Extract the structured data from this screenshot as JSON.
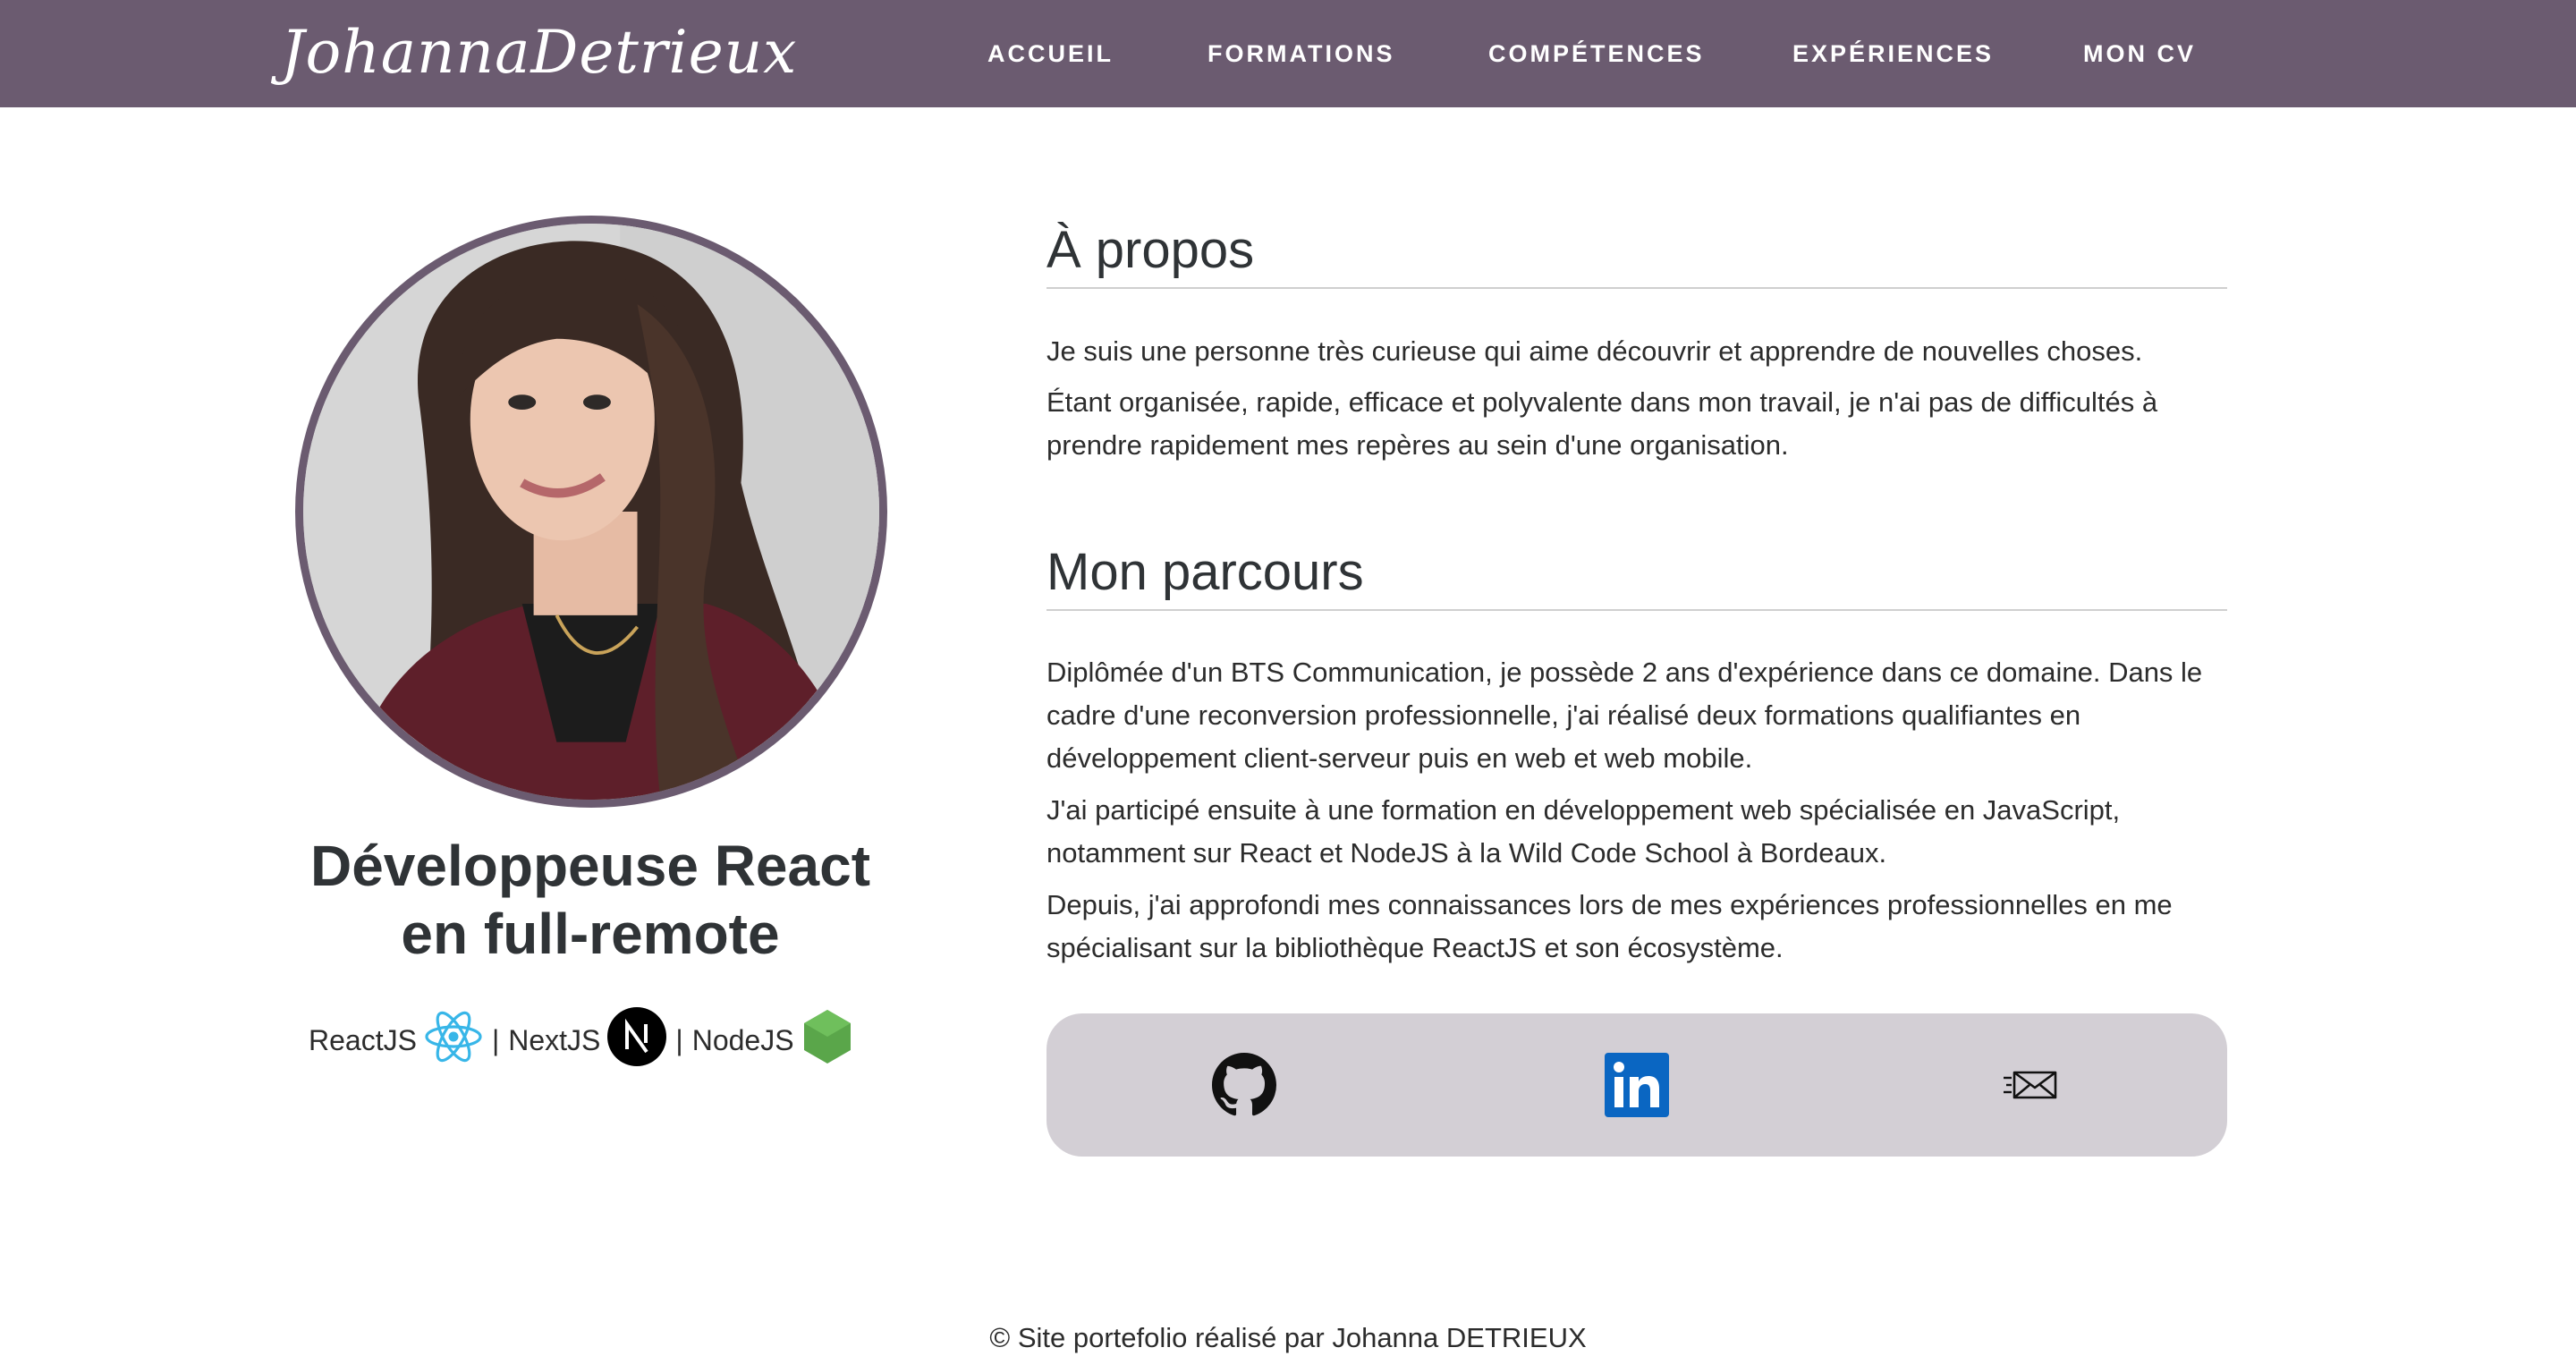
{
  "navbar": {
    "brand": "JohannaDetrieux",
    "items": [
      "ACCUEIL",
      "FORMATIONS",
      "COMPÉTENCES",
      "EXPÉRIENCES",
      "MON CV"
    ],
    "background": "#6b5b70"
  },
  "profile": {
    "headline_line1": "Développeuse React",
    "headline_line2": "en full-remote",
    "stack": {
      "react": "ReactJS",
      "next": "NextJS",
      "node": "NodeJS",
      "separator": "|"
    }
  },
  "about": {
    "title": "À propos",
    "paragraphs": [
      "Je suis une personne très curieuse qui aime découvrir et apprendre de nouvelles choses.",
      "Étant organisée, rapide, efficace et polyvalente dans mon travail, je n'ai pas de difficultés à prendre rapidement mes repères au sein d'une organisation."
    ]
  },
  "parcours": {
    "title": "Mon parcours",
    "paragraphs": [
      "Diplômée d'un BTS Communication, je possède 2 ans d'expérience dans ce domaine. Dans le cadre d'une reconversion professionnelle, j'ai réalisé deux formations qualifiantes en développement client-serveur puis en web et web mobile.",
      "J'ai participé ensuite à une formation en développement web spécialisée en JavaScript, notamment sur React et NodeJS à la Wild Code School à Bordeaux.",
      "Depuis, j'ai approfondi mes connaissances lors de mes expériences professionnelles en me spécialisant sur la bibliothèque ReactJS et son écosystème."
    ]
  },
  "social": {
    "icons": [
      "github-icon",
      "linkedin-icon",
      "mail-icon"
    ],
    "card_color": "#d3cfd5",
    "linkedin_color": "#0a66c2"
  },
  "footer": {
    "text": "© Site portefolio réalisé par Johanna DETRIEUX"
  }
}
